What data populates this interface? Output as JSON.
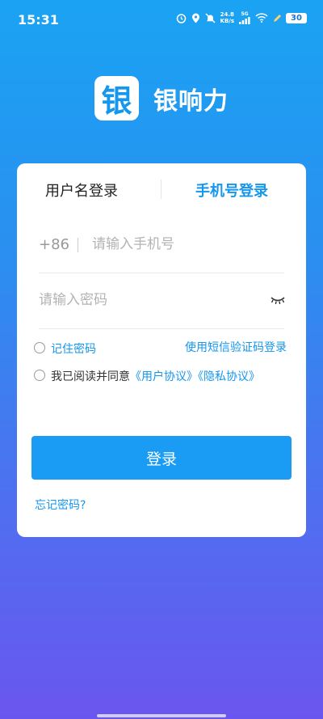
{
  "status_bar": {
    "time": "15:31",
    "net_speed_value": "24.8",
    "net_speed_unit": "KB/s",
    "network_type": "5G",
    "battery": "30",
    "icons": [
      "alarm-icon",
      "location-icon",
      "mute-icon",
      "signal-icon",
      "wifi-icon",
      "battery-icon"
    ]
  },
  "app": {
    "logo_glyph": "银",
    "name": "银响力",
    "brand_color": "#1597ee"
  },
  "tabs": {
    "username_login": "用户名登录",
    "phone_login": "手机号登录",
    "active": "phone_login"
  },
  "form": {
    "country_code": "+86",
    "phone_placeholder": "请输入手机号",
    "password_placeholder": "请输入密码",
    "remember_label": "记住密码",
    "sms_login_link": "使用短信验证码登录",
    "agree_prefix": "我已阅读并同意",
    "user_agreement": "《用户协议》",
    "privacy_policy": "《隐私协议》",
    "login_button": "登录",
    "forgot_password": "忘记密码?"
  }
}
